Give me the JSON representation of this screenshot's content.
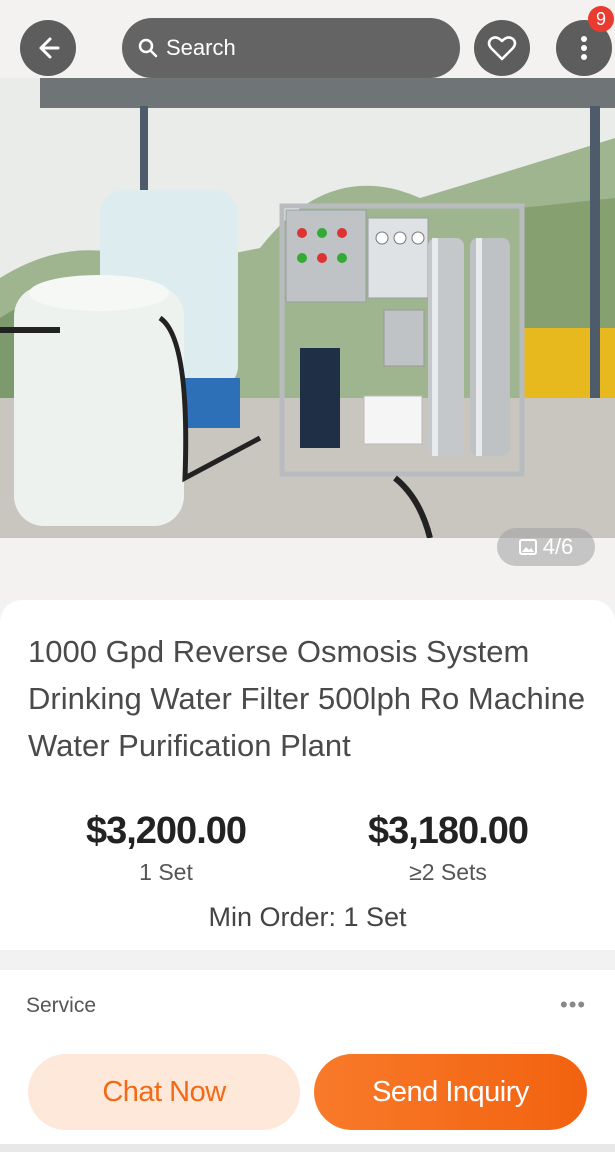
{
  "header": {
    "search_placeholder": "Search",
    "notification_count": "9"
  },
  "gallery": {
    "counter": "4/6"
  },
  "product": {
    "title": "1000 Gpd Reverse Osmosis System Drinking Water Filter 500lph Ro Machine Water Purification Plant",
    "prices": [
      {
        "price": "$3,200.00",
        "quantity": "1 Set"
      },
      {
        "price": "$3,180.00",
        "quantity": "≥2 Sets"
      }
    ],
    "min_order": "Min Order: 1 Set"
  },
  "service": {
    "label": "Service",
    "more": "•••"
  },
  "actions": {
    "chat_label": "Chat Now",
    "inquiry_label": "Send Inquiry"
  },
  "colors": {
    "accent": "#f26a15",
    "badge": "#e93b2f"
  }
}
